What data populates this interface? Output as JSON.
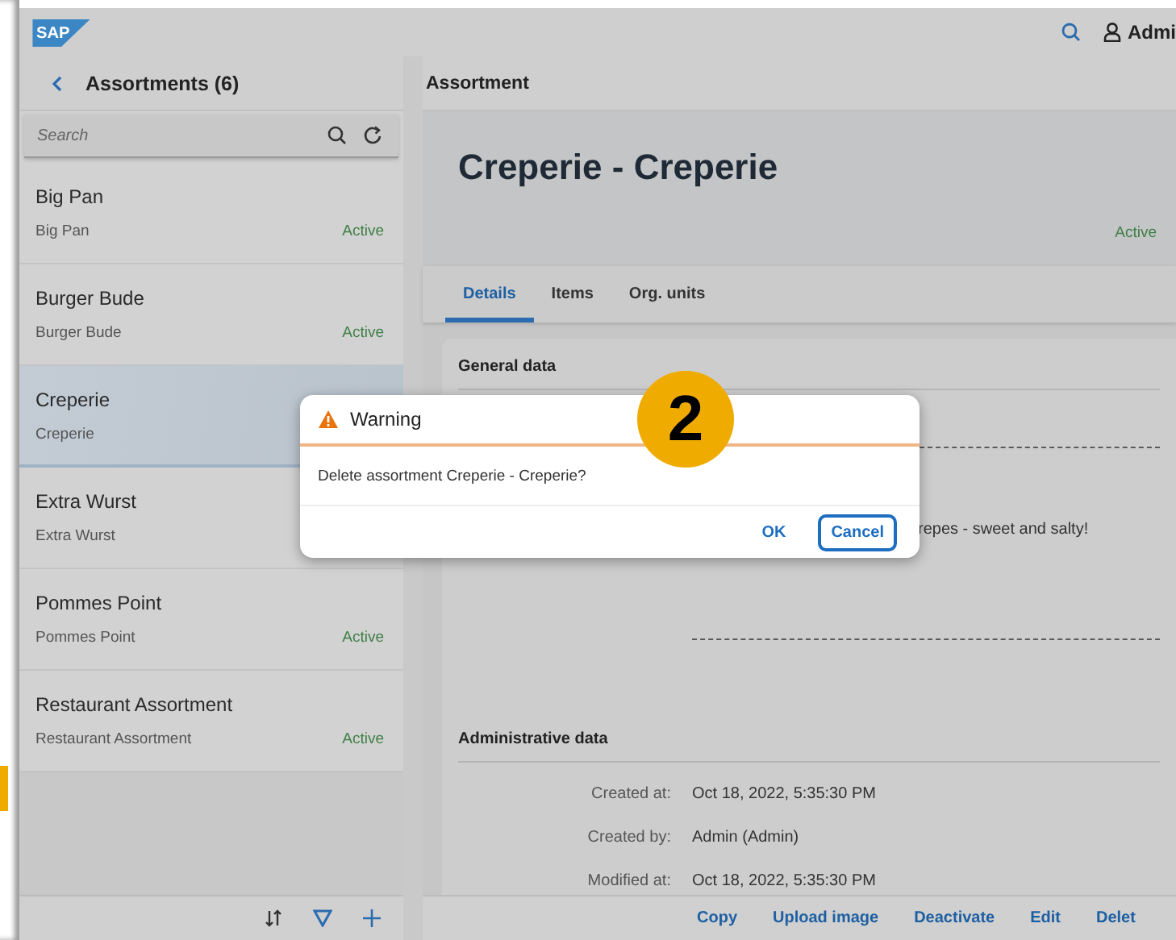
{
  "shell": {
    "logo": "SAP",
    "user": "Admi"
  },
  "master": {
    "title": "Assortments (6)",
    "search": {
      "placeholder": "Search"
    },
    "items": [
      {
        "title": "Big Pan",
        "subtitle": "Big Pan",
        "status": "Active",
        "selected": false
      },
      {
        "title": "Burger Bude",
        "subtitle": "Burger Bude",
        "status": "Active",
        "selected": false
      },
      {
        "title": "Creperie",
        "subtitle": "Creperie",
        "selected": true
      },
      {
        "title": "Extra Wurst",
        "subtitle": "Extra Wurst",
        "selected": false
      },
      {
        "title": "Pommes Point",
        "subtitle": "Pommes Point",
        "status": "Active",
        "selected": false
      },
      {
        "title": "Restaurant Assortment",
        "subtitle": "Restaurant Assortment",
        "status": "Active",
        "selected": false
      }
    ]
  },
  "detail": {
    "title": "Assortment",
    "object_title": "Creperie - Creperie",
    "status": "Active",
    "tabs": [
      {
        "label": "Details",
        "selected": true
      },
      {
        "label": "Items",
        "selected": false
      },
      {
        "label": "Org. units",
        "selected": false
      }
    ],
    "general": {
      "title": "General data",
      "description": "repes - sweet and salty!"
    },
    "admin": {
      "title": "Administrative data",
      "rows": [
        {
          "label": "Created at:",
          "value": "Oct 18, 2022, 5:35:30 PM"
        },
        {
          "label": "Created by:",
          "value": "Admin (Admin)"
        },
        {
          "label": "Modified at:",
          "value": "Oct 18, 2022, 5:35:30 PM"
        }
      ]
    },
    "actions": [
      "Copy",
      "Upload image",
      "Deactivate",
      "Edit",
      "Delet"
    ]
  },
  "dialog": {
    "title": "Warning",
    "message": "Delete assortment Creperie - Creperie?",
    "buttons": [
      {
        "label": "OK",
        "kind": "plain"
      },
      {
        "label": "Cancel",
        "kind": "outlined"
      }
    ]
  },
  "step_badge": "2"
}
